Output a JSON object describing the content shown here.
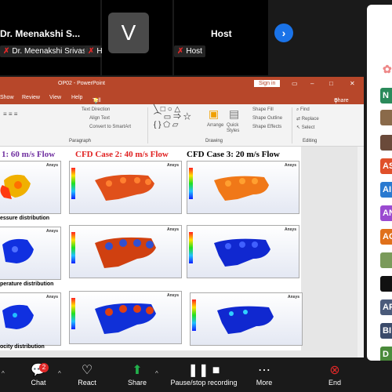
{
  "participants": {
    "tile1_name": "Dr. Meenakshi S...",
    "tile1_tag": "Dr. Meenakshi Srivast...",
    "tile1_host": "Host",
    "tile2_initial": "V",
    "tile3_name": "Host",
    "tile3_tag": "Host"
  },
  "ppt": {
    "window_title": "OP02 - PowerPoint",
    "signin": "Sign in",
    "menu": [
      "Show",
      "Review",
      "View",
      "Help"
    ],
    "tell_me": "Tell me what you want to do",
    "share": "Share",
    "ribbon": {
      "text_direction": "Text Direction",
      "align_text": "Align Text",
      "convert_smartart": "Convert to SmartArt",
      "paragraph": "Paragraph",
      "arrange": "Arrange",
      "quick_styles": "Quick Styles",
      "shape_fill": "Shape Fill",
      "shape_outline": "Shape Outline",
      "shape_effects": "Shape Effects",
      "drawing": "Drawing",
      "find": "Find",
      "replace": "Replace",
      "select": "Select",
      "editing": "Editing"
    }
  },
  "slide": {
    "case1": "1: 60 m/s Flow",
    "case2": "CFD Case 2: 40 m/s Flow",
    "case3": "CFD Case 3: 20 m/s Flow",
    "row1": "essure distribution",
    "row2": "perature distribution",
    "row3": "ocity distribution",
    "logo": "Ansys"
  },
  "side_panel": [
    "N",
    "AS",
    "AI",
    "AN",
    "AC",
    "AP",
    "BI",
    "D"
  ],
  "toolbar": {
    "chat": "Chat",
    "chat_badge": "2",
    "react": "React",
    "share": "Share",
    "record": "Pause/stop recording",
    "more": "More",
    "end": "End"
  },
  "colors": {
    "ppt_red": "#b7472a",
    "case1_color": "#7030a0",
    "case2_color": "#e02020",
    "case3_color": "#000000",
    "share_green": "#22b14c",
    "end_red": "#e02828"
  }
}
